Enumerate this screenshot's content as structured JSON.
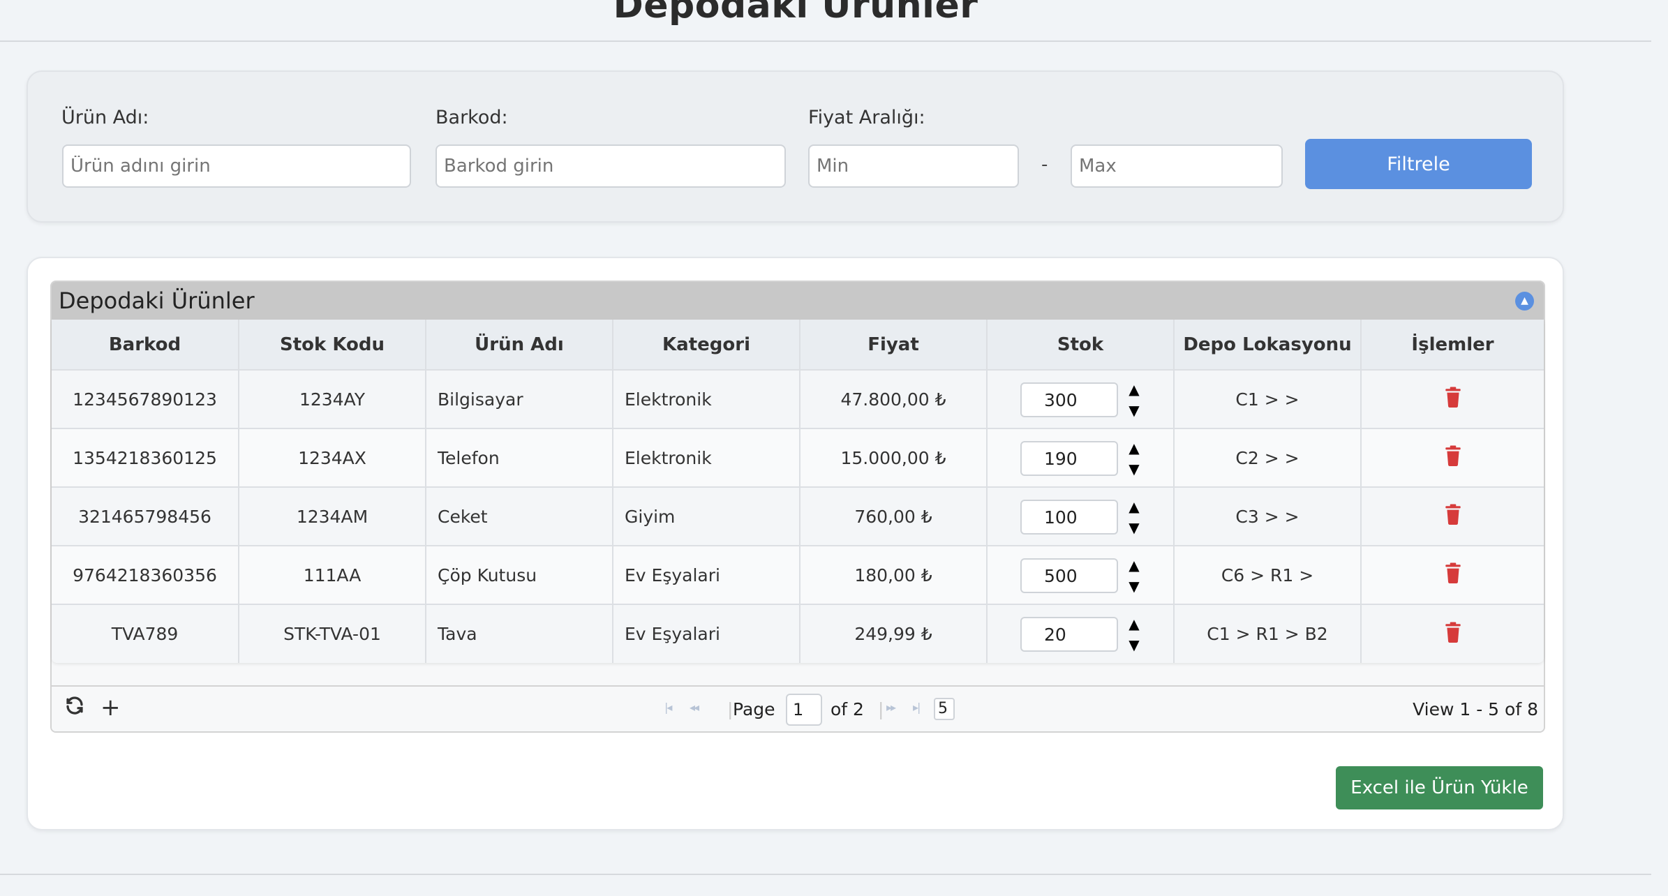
{
  "page": {
    "title": "Depodaki Ürünler"
  },
  "filters": {
    "product_name": {
      "label": "Ürün Adı:",
      "placeholder": "Ürün adını girin"
    },
    "barcode": {
      "label": "Barkod:",
      "placeholder": "Barkod girin"
    },
    "price_range": {
      "label": "Fiyat Aralığı:",
      "min_placeholder": "Min",
      "max_placeholder": "Max",
      "separator": "-"
    },
    "filter_button": "Filtrele"
  },
  "grid": {
    "caption": "Depodaki Ürünler",
    "columns": [
      "Barkod",
      "Stok Kodu",
      "Ürün Adı",
      "Kategori",
      "Fiyat",
      "Stok",
      "Depo Lokasyonu",
      "İşlemler"
    ],
    "rows": [
      {
        "barkod": "1234567890123",
        "stok_kodu": "1234AY",
        "urun_adi": "Bilgisayar",
        "kategori": "Elektronik",
        "fiyat": "47.800,00 ₺",
        "stok": "300",
        "lokasyon": "C1 > >"
      },
      {
        "barkod": "1354218360125",
        "stok_kodu": "1234AX",
        "urun_adi": "Telefon",
        "kategori": "Elektronik",
        "fiyat": "15.000,00 ₺",
        "stok": "190",
        "lokasyon": "C2 > >"
      },
      {
        "barkod": "321465798456",
        "stok_kodu": "1234AM",
        "urun_adi": "Ceket",
        "kategori": "Giyim",
        "fiyat": "760,00 ₺",
        "stok": "100",
        "lokasyon": "C3 > >"
      },
      {
        "barkod": "9764218360356",
        "stok_kodu": "111AA",
        "urun_adi": "Çöp Kutusu",
        "kategori": "Ev Eşyalari",
        "fiyat": "180,00 ₺",
        "stok": "500",
        "lokasyon": "C6 > R1 >"
      },
      {
        "barkod": "TVA789",
        "stok_kodu": "STK-TVA-01",
        "urun_adi": "Tava",
        "kategori": "Ev Eşyalari",
        "fiyat": "249,99 ₺",
        "stok": "20",
        "lokasyon": "C1 > R1 > B2"
      }
    ],
    "pager": {
      "page_label": "Page",
      "current_page": "1",
      "of_label": "of 2",
      "rows_per_page": "5",
      "view_info": "View 1 - 5 of 8"
    }
  },
  "actions": {
    "excel_upload": "Excel ile Ürün Yükle"
  },
  "colors": {
    "primary": "#5b90e0",
    "success": "#3e8e58",
    "danger": "#d63b3b"
  },
  "icons": [
    "refresh-icon",
    "add-icon",
    "trash-icon",
    "collapse-icon",
    "first-page-icon",
    "prev-page-icon",
    "next-page-icon",
    "last-page-icon"
  ]
}
